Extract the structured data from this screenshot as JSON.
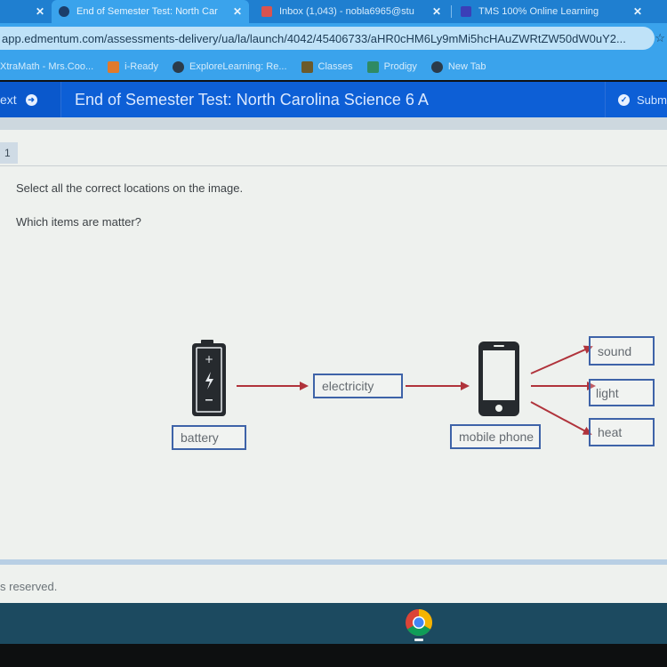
{
  "browser": {
    "tabs": [
      {
        "label": "",
        "active": false,
        "close": "✕"
      },
      {
        "label": "End of Semester Test: North Car",
        "active": true,
        "close": "✕",
        "icon": "edmentum-icon"
      },
      {
        "label": "Inbox (1,043) - nobla6965@stu",
        "active": false,
        "close": "✕",
        "icon": "gmail-icon"
      },
      {
        "label": "TMS 100% Online Learning",
        "active": false,
        "close": "✕",
        "icon": "classroom-icon"
      }
    ],
    "url": "app.edmentum.com/assessments-delivery/ua/la/launch/4042/45406733/aHR0cHM6Ly9mMi5hcHAuZWRtZW50dW0uY2...",
    "bookmark_star": "☆",
    "bookmarks": [
      {
        "label": "XtraMath - Mrs.Coo...",
        "icon": "xtramath-icon"
      },
      {
        "label": "i-Ready",
        "icon": "iready-icon"
      },
      {
        "label": "ExploreLearning: Re...",
        "icon": "globe-icon"
      },
      {
        "label": "Classes",
        "icon": "classes-icon"
      },
      {
        "label": "Prodigy",
        "icon": "prodigy-icon"
      },
      {
        "label": "New Tab",
        "icon": "globe-icon"
      }
    ]
  },
  "header": {
    "next_label": "ext",
    "title": "End of Semester Test: North Carolina Science 6 A",
    "submit_label": "Subm"
  },
  "question": {
    "number": "1",
    "instruction": "Select all the correct locations on the image.",
    "prompt": "Which items are matter?",
    "hotspots": [
      {
        "id": "battery",
        "label": "battery"
      },
      {
        "id": "electricity",
        "label": "electricity"
      },
      {
        "id": "mobile-phone",
        "label": "mobile phone"
      },
      {
        "id": "sound",
        "label": "sound"
      },
      {
        "id": "light",
        "label": "light"
      },
      {
        "id": "heat",
        "label": "heat"
      }
    ]
  },
  "footer": {
    "text": "s reserved."
  },
  "colors": {
    "header_blue": "#0d5fd6",
    "arrow_red": "#b0333b",
    "hotspot_border": "#3e63a8"
  }
}
